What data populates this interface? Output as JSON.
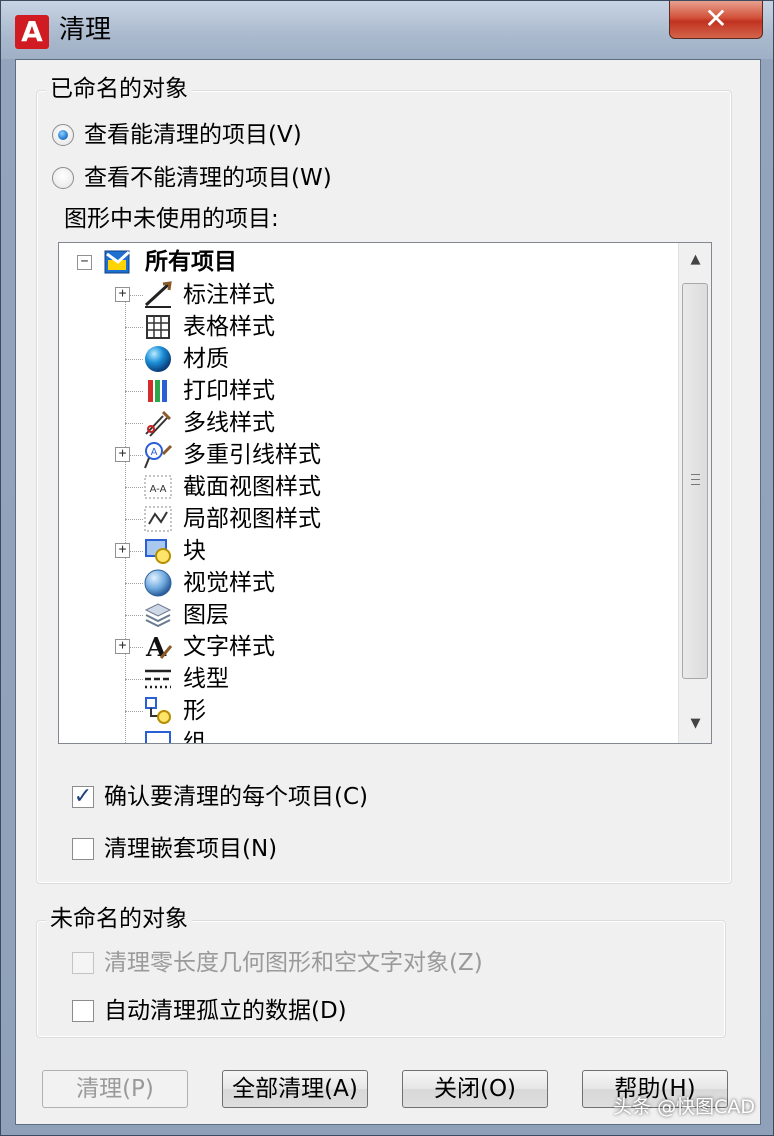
{
  "window": {
    "title": "清理",
    "app_icon": "A",
    "close": "✕"
  },
  "named": {
    "group_label": "已命名的对象",
    "radio_purgeable": "查看能清理的项目(V)",
    "radio_unpurgeable": "查看不能清理的项目(W)",
    "tree_label": "图形中未使用的项目:",
    "tree": {
      "root": "所有项目",
      "items": [
        {
          "label": "标注样式",
          "icon": "dimension-style-icon",
          "expandable": true
        },
        {
          "label": "表格样式",
          "icon": "table-style-icon",
          "expandable": false
        },
        {
          "label": "材质",
          "icon": "material-sphere-icon",
          "expandable": false
        },
        {
          "label": "打印样式",
          "icon": "plot-style-icon",
          "expandable": false
        },
        {
          "label": "多线样式",
          "icon": "multiline-style-icon",
          "expandable": false
        },
        {
          "label": "多重引线样式",
          "icon": "multileader-style-icon",
          "expandable": true
        },
        {
          "label": "截面视图样式",
          "icon": "section-view-style-icon",
          "expandable": false
        },
        {
          "label": "局部视图样式",
          "icon": "detail-view-style-icon",
          "expandable": false
        },
        {
          "label": "块",
          "icon": "block-icon",
          "expandable": true
        },
        {
          "label": "视觉样式",
          "icon": "visual-style-icon",
          "expandable": false
        },
        {
          "label": "图层",
          "icon": "layer-icon",
          "expandable": false
        },
        {
          "label": "文字样式",
          "icon": "text-style-icon",
          "expandable": true
        },
        {
          "label": "线型",
          "icon": "linetype-icon",
          "expandable": false
        },
        {
          "label": "形",
          "icon": "shape-icon",
          "expandable": false
        },
        {
          "label": "组",
          "icon": "group-icon",
          "expandable": false
        }
      ]
    },
    "check_confirm": "确认要清理的每个项目(C)",
    "check_nested": "清理嵌套项目(N)"
  },
  "unnamed": {
    "group_label": "未命名的对象",
    "check_zero_length": "清理零长度几何图形和空文字对象(Z)",
    "check_orphaned": "自动清理孤立的数据(D)"
  },
  "buttons": {
    "purge": "清理(P)",
    "purge_all": "全部清理(A)",
    "close": "关闭(O)",
    "help": "帮助(H)"
  },
  "watermark": "头条 @快图CAD",
  "colors": {
    "accent": "#1c6fc8",
    "close_red": "#c03220",
    "autodesk_red": "#d01b22"
  }
}
